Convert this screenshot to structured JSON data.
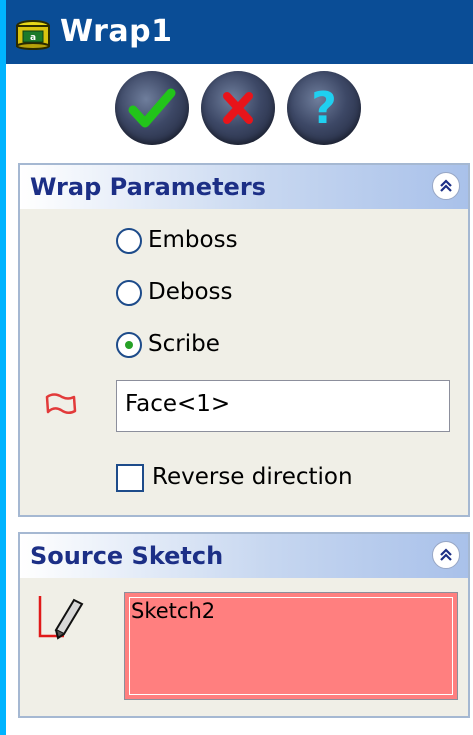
{
  "window": {
    "title": "Wrap1"
  },
  "actions": {
    "ok": {
      "icon": "checkmark-icon",
      "color": "#22c41a"
    },
    "cancel": {
      "icon": "x-icon",
      "color": "#e8141a"
    },
    "help": {
      "icon": "question-mark-icon",
      "color": "#1fd0f0"
    }
  },
  "wrap_parameters": {
    "title": "Wrap Parameters",
    "options": [
      {
        "label": "Emboss",
        "selected": false
      },
      {
        "label": "Deboss",
        "selected": false
      },
      {
        "label": "Scribe",
        "selected": true
      }
    ],
    "face_field_value": "Face<1>",
    "face_icon": "face-selection-icon",
    "reverse_direction": {
      "label": "Reverse direction",
      "checked": false
    }
  },
  "source_sketch": {
    "title": "Source Sketch",
    "sketch_icon": "sketch-pencil-icon",
    "selection_value": "Sketch2",
    "selection_color": "#ff7f7f"
  },
  "colors": {
    "title_bar": "#0a4d96",
    "frame": "#00b4ff",
    "group_title": "#1c2f86"
  }
}
